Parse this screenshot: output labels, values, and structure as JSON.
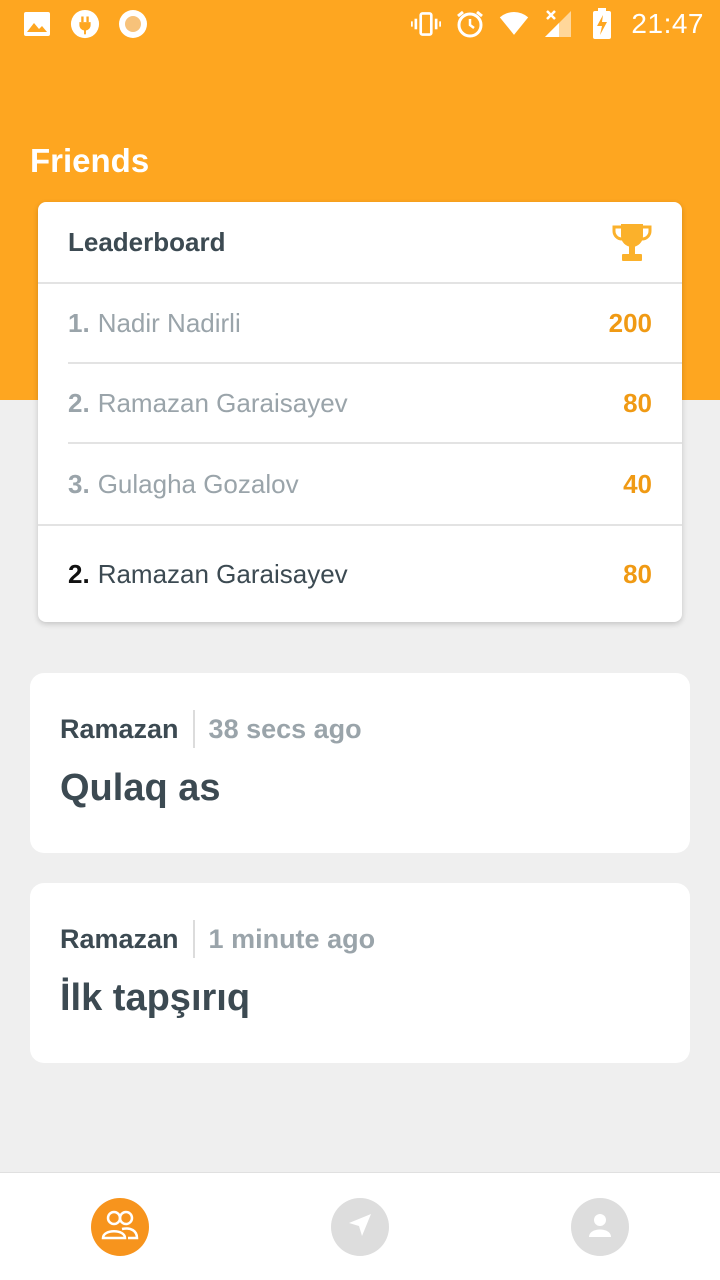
{
  "status_bar": {
    "time": "21:47",
    "icons": [
      "image-icon",
      "plug-icon",
      "circle-icon",
      "vibrate-icon",
      "alarm-icon",
      "wifi-icon",
      "signal-icon",
      "battery-charging-icon"
    ]
  },
  "page": {
    "title": "Friends"
  },
  "leaderboard": {
    "title": "Leaderboard",
    "icon": "trophy-icon",
    "rows": [
      {
        "rank": "1.",
        "name": "Nadir Nadirli",
        "score": "200"
      },
      {
        "rank": "2.",
        "name": "Ramazan Garaisayev",
        "score": "80"
      },
      {
        "rank": "3.",
        "name": "Gulagha Gozalov",
        "score": "40"
      }
    ],
    "current_user": {
      "rank": "2.",
      "name": "Ramazan Garaisayev",
      "score": "80"
    }
  },
  "feed": [
    {
      "user": "Ramazan",
      "time": "38 secs ago",
      "text": "Qulaq as"
    },
    {
      "user": "Ramazan",
      "time": "1 minute ago",
      "text": "İlk tapşırıq"
    }
  ],
  "bottom_nav": {
    "items": [
      {
        "icon": "friends-icon",
        "active": true
      },
      {
        "icon": "compass-icon",
        "active": false
      },
      {
        "icon": "profile-icon",
        "active": false
      }
    ]
  },
  "colors": {
    "header": "#fea620",
    "accent": "#f7941d",
    "score": "#f09a14",
    "background": "#efefef"
  }
}
